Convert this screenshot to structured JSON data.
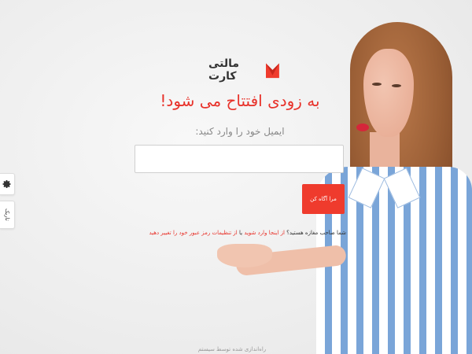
{
  "brand": {
    "name": "مالتی کارت",
    "logo_icon": "red-m-logo-icon"
  },
  "headline": "به زودی افتتاح می شود!",
  "email": {
    "prompt": "ایمیل خود را وارد کنید:",
    "value": "",
    "placeholder": ""
  },
  "notify_button": "مرا آگاه کن",
  "owner": {
    "question": "شما صاحب مغازه هستید؟",
    "link_login": "از اینجا وارد شوید",
    "connector": "یا",
    "link_change": "از تنظیمات رمز عبور خود را تغییر دهید"
  },
  "footer": "راه‌اندازی شده توسط سیستم",
  "side": {
    "settings_icon": "gear-icon",
    "dark_label": "تاریک"
  },
  "colors": {
    "accent": "#ef3b2d",
    "text": "#333333",
    "muted": "#888888"
  }
}
